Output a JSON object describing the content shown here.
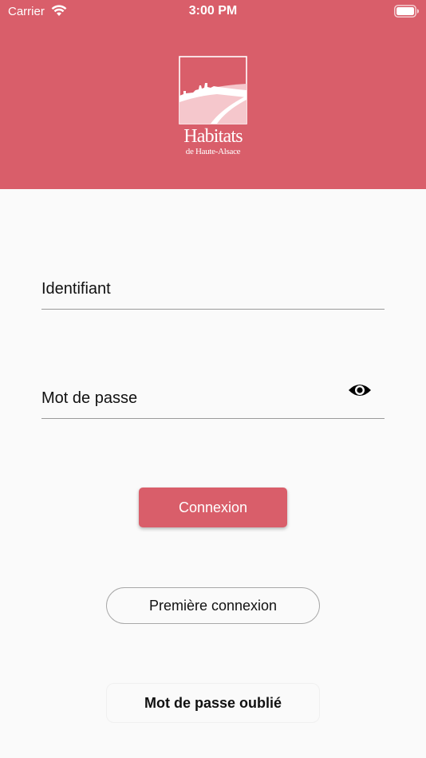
{
  "status_bar": {
    "carrier": "Carrier",
    "time": "3:00 PM",
    "icons": [
      "wifi-icon",
      "battery-icon"
    ]
  },
  "header": {
    "background_color": "#d95e6a",
    "logo": {
      "title": "Habitats",
      "subtitle": "de Haute-Alsace"
    }
  },
  "form": {
    "identifiant": {
      "value": "",
      "placeholder": "Identifiant"
    },
    "password": {
      "value": "",
      "placeholder": "Mot de passe",
      "toggle_icon": "eye-icon"
    }
  },
  "buttons": {
    "login_label": "Connexion",
    "first_login_label": "Première connexion",
    "forgot_password_label": "Mot de passe oublié"
  },
  "colors": {
    "accent": "#d95e6a",
    "background": "#fafafa",
    "text": "#111111"
  }
}
